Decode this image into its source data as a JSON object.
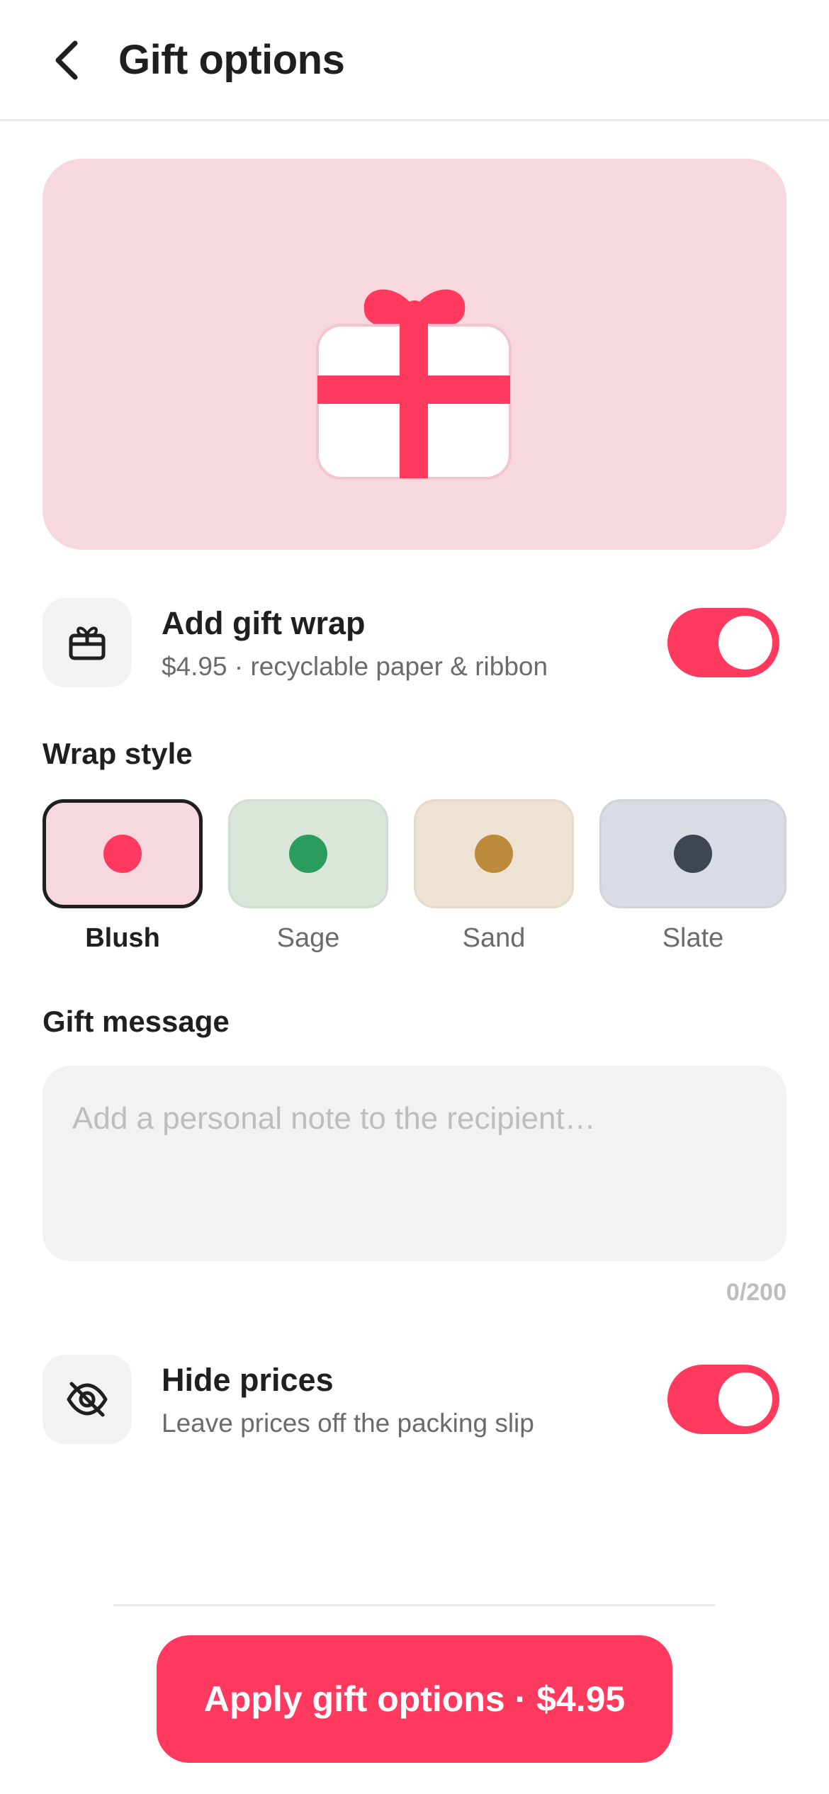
{
  "header": {
    "title": "Gift options",
    "back_icon": "chevron-left-icon"
  },
  "hero": {
    "illustration": "gift-box-illustration",
    "background": "#f6d8de",
    "accent": "#ff3a5e"
  },
  "gift_wrap": {
    "title": "Add gift wrap",
    "subtitle": "$4.95 · recyclable paper & ribbon",
    "icon": "gift-box-icon",
    "enabled": true
  },
  "wrap_style": {
    "label": "Wrap style",
    "selected": "Blush",
    "options": [
      {
        "label": "Blush",
        "swatch": "#f6d8de",
        "dot": "#ff3a5e"
      },
      {
        "label": "Sage",
        "swatch": "#dbe6da",
        "dot": "#2a9d5c"
      },
      {
        "label": "Sand",
        "swatch": "#eee3d3",
        "dot": "#bb8a3b"
      },
      {
        "label": "Slate",
        "swatch": "#d9dce2",
        "dot": "#3e4651"
      }
    ]
  },
  "gift_message": {
    "label": "Gift message",
    "placeholder": "Add a personal note to the recipient…",
    "value": "",
    "counter": "0/200"
  },
  "hide_prices": {
    "title": "Hide prices",
    "subtitle": "Leave prices off the packing slip",
    "icon": "eye-off-icon",
    "enabled": true
  },
  "cta": {
    "label": "Apply gift options · $4.95"
  },
  "colors": {
    "accent": "#ff3a5e",
    "text": "#1f1f1f",
    "muted": "#6b6b6b"
  }
}
